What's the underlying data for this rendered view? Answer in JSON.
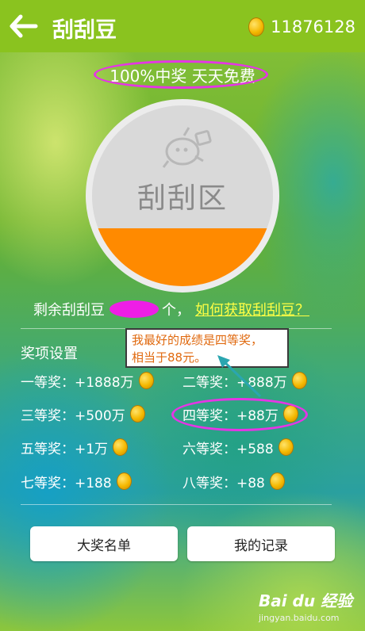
{
  "header": {
    "title": "刮刮豆",
    "balance": "11876128",
    "back_icon": "back-arrow-icon",
    "bean_icon": "gold-bean-icon",
    "bar_color": "#8ac31f"
  },
  "slogan": "100%中奖 天天免费",
  "scratch_card": {
    "label": "刮刮区",
    "fill_color": "#ff8a00"
  },
  "remaining": {
    "prefix": "剩余刮刮豆",
    "suffix": "个，",
    "link": "如何获取刮刮豆？"
  },
  "callout": {
    "line1": "我最好的成绩是四等奖，",
    "line2": "相当于88元。"
  },
  "prizes": {
    "heading": "奖项设置",
    "items": [
      "一等奖：+1888万",
      "二等奖：+888万",
      "三等奖：+500万",
      "四等奖：+88万",
      "五等奖：+1万",
      "六等奖：+588",
      "七等奖：+188",
      "八等奖：+88"
    ]
  },
  "buttons": {
    "top_prize_list": "大奖名单",
    "my_records": "我的记录"
  },
  "watermark": {
    "logo": "Bai du 经验",
    "url": "jingyan.baidu.com"
  }
}
